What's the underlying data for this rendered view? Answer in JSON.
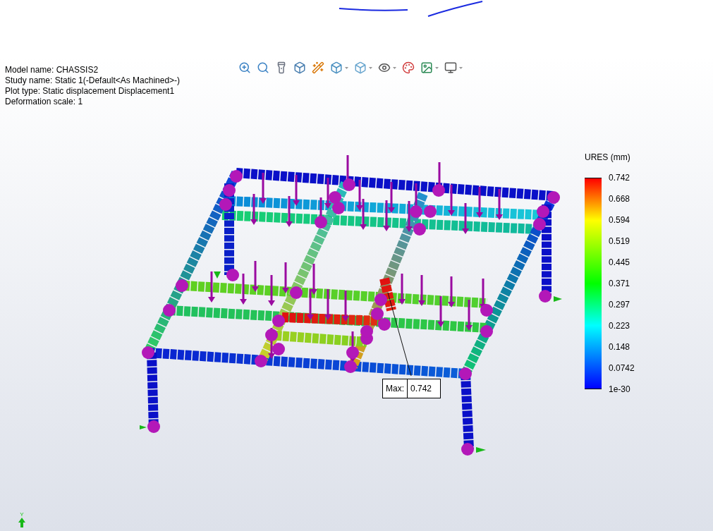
{
  "info": {
    "lines": [
      "Model name: CHASSIS2",
      "Study name: Static 1(-Default<As Machined>-)",
      "Plot type: Static displacement Displacement1",
      "Deformation scale: 1"
    ]
  },
  "toolbar": [
    {
      "dropdown": false
    },
    {
      "dropdown": false
    },
    {
      "dropdown": false
    },
    {
      "dropdown": false
    },
    {
      "dropdown": false
    },
    {
      "dropdown": true
    },
    {
      "dropdown": true
    },
    {
      "dropdown": true
    },
    {
      "dropdown": false
    },
    {
      "dropdown": true
    },
    {
      "dropdown": true
    }
  ],
  "legend": {
    "title": "URES (mm)",
    "ticks": [
      "0.742",
      "0.668",
      "0.594",
      "0.519",
      "0.445",
      "0.371",
      "0.297",
      "0.223",
      "0.148",
      "0.0742",
      "1e-30"
    ]
  },
  "max_probe": {
    "label": "Max:",
    "value": "0.742"
  },
  "triad": {
    "axis_label": "Y"
  }
}
